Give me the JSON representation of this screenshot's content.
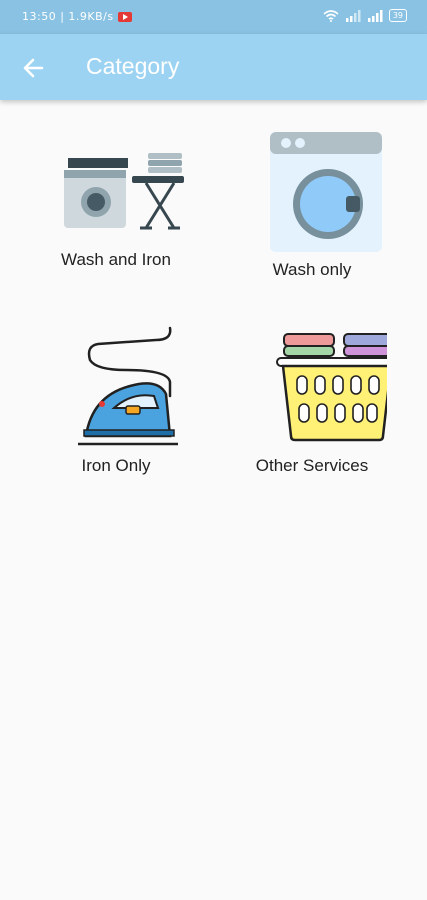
{
  "status_bar": {
    "time": "13:50",
    "speed": "1.9KB/s",
    "battery": "39"
  },
  "header": {
    "title": "Category",
    "back_icon": "arrow-left-icon"
  },
  "categories": [
    {
      "label": "Wash and Iron",
      "icon": "washer-ironing-board-icon"
    },
    {
      "label": "Wash only",
      "icon": "washing-machine-icon"
    },
    {
      "label": "Iron Only",
      "icon": "iron-icon"
    },
    {
      "label": "Other Services",
      "icon": "laundry-basket-icon"
    }
  ],
  "colors": {
    "app_bar": "#9dd3f2",
    "status_bar": "#89c2e3",
    "background": "#fafafa"
  }
}
